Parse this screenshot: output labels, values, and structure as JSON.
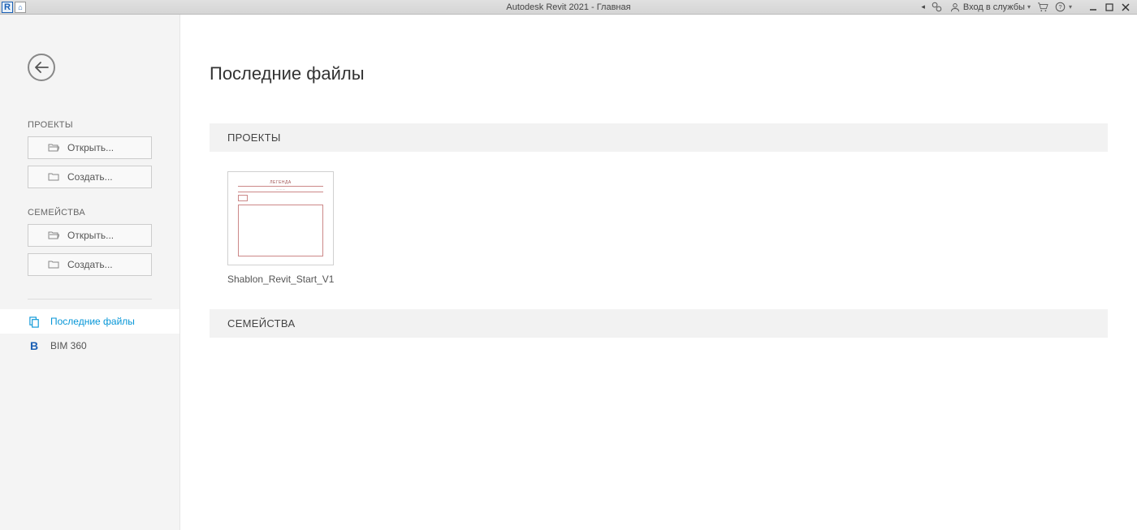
{
  "titlebar": {
    "title": "Autodesk Revit 2021 - Главная",
    "login_label": "Вход в службы"
  },
  "sidebar": {
    "sections": {
      "projects": {
        "label": "ПРОЕКТЫ",
        "open": "Открыть...",
        "create": "Создать..."
      },
      "families": {
        "label": "СЕМЕЙСТВА",
        "open": "Открыть...",
        "create": "Создать..."
      }
    },
    "nav": {
      "recent": "Последние файлы",
      "bim360": "BIM 360"
    }
  },
  "main": {
    "title": "Последние файлы",
    "projects_header": "ПРОЕКТЫ",
    "families_header": "СЕМЕЙСТВА",
    "recent_projects": [
      {
        "name": "Shablon_Revit_Start_V1"
      }
    ]
  }
}
